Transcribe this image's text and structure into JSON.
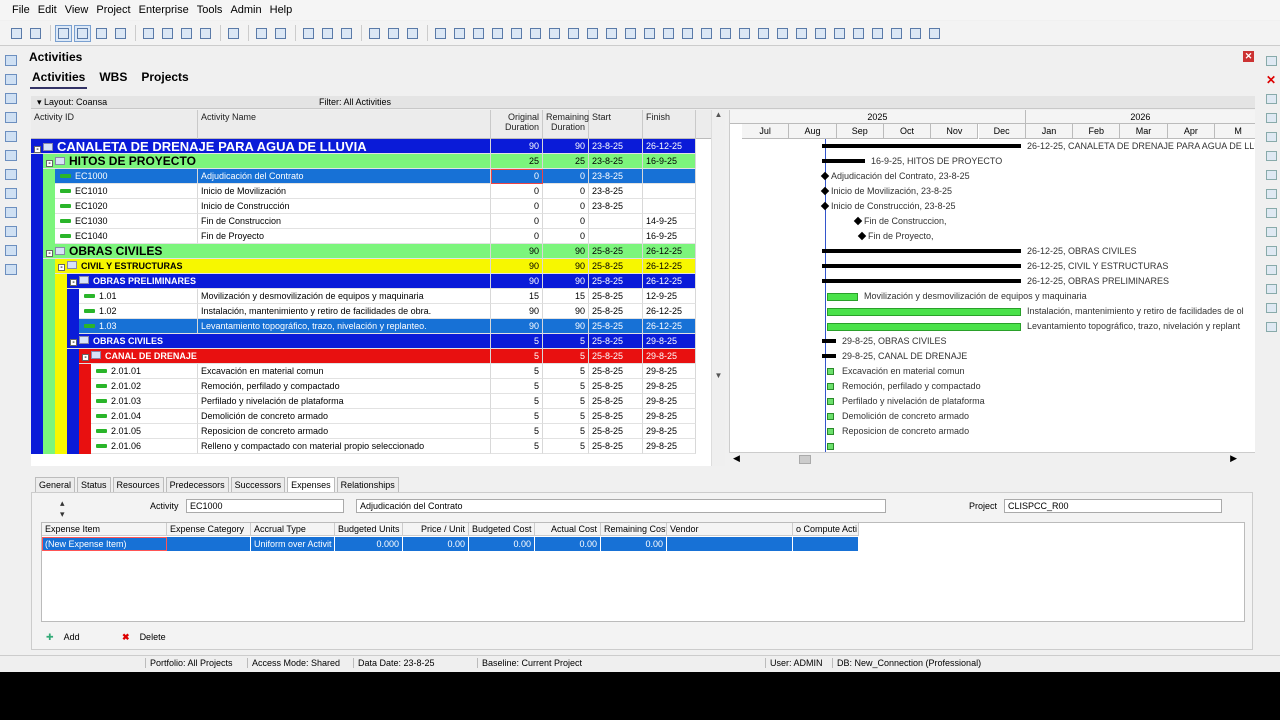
{
  "menu": [
    "File",
    "Edit",
    "View",
    "Project",
    "Enterprise",
    "Tools",
    "Admin",
    "Help"
  ],
  "panel_title": "Activities",
  "view_tabs": [
    "Activities",
    "WBS",
    "Projects"
  ],
  "layout_label": "Layout: Coansa",
  "filter_label": "Filter: All Activities",
  "columns": {
    "id": "Activity ID",
    "name": "Activity Name",
    "orig": "Original Duration",
    "rem": "Remaining Duration",
    "start": "Start",
    "finish": "Finish"
  },
  "rows": [
    {
      "level": 0,
      "type": "wbs",
      "id": "CANALETA DE DRENAJE PARA AGUA DE LLUVIA",
      "name": "",
      "orig": "90",
      "rem": "90",
      "start": "23-8-25",
      "finish": "26-12-25",
      "bg": "#0a1bd8",
      "fg": "#ffffff",
      "gantt_label": "26-12-25, CANALETA DE DRENAJE PARA AGUA DE LLUVIA"
    },
    {
      "level": 1,
      "type": "wbs",
      "id": "HITOS DE PROYECTO",
      "name": "",
      "orig": "25",
      "rem": "25",
      "start": "23-8-25",
      "finish": "16-9-25",
      "bg": "#7cf57c",
      "fg": "#000000",
      "gantt_label": "16-9-25, HITOS DE PROYECTO"
    },
    {
      "level": 2,
      "type": "act",
      "id": "EC1000",
      "name": "Adjudicación del Contrato",
      "orig": "0",
      "rem": "0",
      "start": "23-8-25",
      "finish": "",
      "bg": "#1771d6",
      "fg": "#ffffff",
      "selected": true,
      "gantt_label": "Adjudicación del Contrato, 23-8-25"
    },
    {
      "level": 2,
      "type": "act",
      "id": "EC1010",
      "name": "Inicio de Movilización",
      "orig": "0",
      "rem": "0",
      "start": "23-8-25",
      "finish": "",
      "bg": "#ffffff",
      "fg": "#000000",
      "gantt_label": "Inicio de Movilización, 23-8-25"
    },
    {
      "level": 2,
      "type": "act",
      "id": "EC1020",
      "name": "Inicio de Construcción",
      "orig": "0",
      "rem": "0",
      "start": "23-8-25",
      "finish": "",
      "bg": "#ffffff",
      "fg": "#000000",
      "gantt_label": "Inicio de Construcción, 23-8-25"
    },
    {
      "level": 2,
      "type": "act",
      "id": "EC1030",
      "name": "Fin de Construccion",
      "orig": "0",
      "rem": "0",
      "start": "",
      "finish": "14-9-25",
      "bg": "#ffffff",
      "fg": "#000000",
      "gantt_label": "Fin de Construccion,"
    },
    {
      "level": 2,
      "type": "act",
      "id": "EC1040",
      "name": "Fin de Proyecto",
      "orig": "0",
      "rem": "0",
      "start": "",
      "finish": "16-9-25",
      "bg": "#ffffff",
      "fg": "#000000",
      "gantt_label": "Fin de Proyecto,"
    },
    {
      "level": 1,
      "type": "wbs",
      "id": "OBRAS CIVILES",
      "name": "",
      "orig": "90",
      "rem": "90",
      "start": "25-8-25",
      "finish": "26-12-25",
      "bg": "#7cf57c",
      "fg": "#000000",
      "gantt_label": "26-12-25, OBRAS CIVILES"
    },
    {
      "level": 2,
      "type": "wbs",
      "id": "CIVIL Y ESTRUCTURAS",
      "name": "",
      "orig": "90",
      "rem": "90",
      "start": "25-8-25",
      "finish": "26-12-25",
      "bg": "#f7f700",
      "fg": "#000000",
      "gantt_label": "26-12-25, CIVIL Y ESTRUCTURAS"
    },
    {
      "level": 3,
      "type": "wbs",
      "id": "OBRAS PRELIMINARES",
      "name": "",
      "orig": "90",
      "rem": "90",
      "start": "25-8-25",
      "finish": "26-12-25",
      "bg": "#0a1bd8",
      "fg": "#ffffff",
      "gantt_label": "26-12-25, OBRAS PRELIMINARES"
    },
    {
      "level": 4,
      "type": "act",
      "id": "1.01",
      "name": "Movilización y desmovilización de equipos y maquinaria",
      "orig": "15",
      "rem": "15",
      "start": "25-8-25",
      "finish": "12-9-25",
      "bg": "#ffffff",
      "fg": "#000000",
      "gantt_label": "Movilización y desmovilización de equipos y maquinaria"
    },
    {
      "level": 4,
      "type": "act",
      "id": "1.02",
      "name": "Instalación, mantenimiento y retiro de facilidades de obra.",
      "orig": "90",
      "rem": "90",
      "start": "25-8-25",
      "finish": "26-12-25",
      "bg": "#ffffff",
      "fg": "#000000",
      "gantt_label": "Instalación, mantenimiento y retiro de facilidades de ol"
    },
    {
      "level": 4,
      "type": "act",
      "id": "1.03",
      "name": "Levantamiento topográfico, trazo, nivelación y replanteo.",
      "orig": "90",
      "rem": "90",
      "start": "25-8-25",
      "finish": "26-12-25",
      "bg": "#1771d6",
      "fg": "#ffffff",
      "gantt_label": "Levantamiento topográfico, trazo, nivelación y replant"
    },
    {
      "level": 3,
      "type": "wbs",
      "id": "OBRAS CIVILES",
      "name": "",
      "orig": "5",
      "rem": "5",
      "start": "25-8-25",
      "finish": "29-8-25",
      "bg": "#0a1bd8",
      "fg": "#ffffff",
      "gantt_label": "29-8-25, OBRAS CIVILES"
    },
    {
      "level": 4,
      "type": "wbs",
      "id": "CANAL DE DRENAJE",
      "name": "",
      "orig": "5",
      "rem": "5",
      "start": "25-8-25",
      "finish": "29-8-25",
      "bg": "#e81010",
      "fg": "#ffffff",
      "gantt_label": "29-8-25, CANAL DE DRENAJE"
    },
    {
      "level": 5,
      "type": "act",
      "id": "2.01.01",
      "name": "Excavación en material comun",
      "orig": "5",
      "rem": "5",
      "start": "25-8-25",
      "finish": "29-8-25",
      "bg": "#ffffff",
      "fg": "#000000",
      "gantt_label": "Excavación en material comun"
    },
    {
      "level": 5,
      "type": "act",
      "id": "2.01.02",
      "name": "Remoción, perfilado y compactado",
      "orig": "5",
      "rem": "5",
      "start": "25-8-25",
      "finish": "29-8-25",
      "bg": "#ffffff",
      "fg": "#000000",
      "gantt_label": "Remoción, perfilado y compactado"
    },
    {
      "level": 5,
      "type": "act",
      "id": "2.01.03",
      "name": "Perfilado y nivelación de plataforma",
      "orig": "5",
      "rem": "5",
      "start": "25-8-25",
      "finish": "29-8-25",
      "bg": "#ffffff",
      "fg": "#000000",
      "gantt_label": "Perfilado y nivelación de plataforma"
    },
    {
      "level": 5,
      "type": "act",
      "id": "2.01.04",
      "name": "Demolición de concreto armado",
      "orig": "5",
      "rem": "5",
      "start": "25-8-25",
      "finish": "29-8-25",
      "bg": "#ffffff",
      "fg": "#000000",
      "gantt_label": "Demolición de concreto armado"
    },
    {
      "level": 5,
      "type": "act",
      "id": "2.01.05",
      "name": "Reposicion de concreto armado",
      "orig": "5",
      "rem": "5",
      "start": "25-8-25",
      "finish": "29-8-25",
      "bg": "#ffffff",
      "fg": "#000000",
      "gantt_label": "Reposicion de concreto armado"
    },
    {
      "level": 5,
      "type": "act",
      "id": "2.01.06",
      "name": "Relleno y compactado con material propio seleccionado",
      "orig": "5",
      "rem": "5",
      "start": "25-8-25",
      "finish": "29-8-25",
      "bg": "#ffffff",
      "fg": "#000000",
      "gantt_label": ""
    }
  ],
  "timescale": {
    "years": [
      "2025",
      "2026"
    ],
    "months": [
      "Jul",
      "Aug",
      "Sep",
      "Oct",
      "Nov",
      "Dec",
      "Jan",
      "Feb",
      "Mar",
      "Apr",
      "M"
    ]
  },
  "detail_tabs": [
    "General",
    "Status",
    "Resources",
    "Predecessors",
    "Successors",
    "Expenses",
    "Relationships"
  ],
  "detail": {
    "activity_label": "Activity",
    "activity_id": "EC1000",
    "activity_name": "Adjudicación del Contrato",
    "project_label": "Project",
    "project_id": "CLISPCC_R00",
    "expense_columns": [
      "Expense Item",
      "Expense Category",
      "Accrual Type",
      "Budgeted Units",
      "Price / Unit",
      "Budgeted Cost",
      "Actual Cost",
      "Remaining Cost",
      "Vendor",
      "o Compute Acti"
    ],
    "expense_row": [
      "(New Expense Item)",
      "",
      "Uniform over Activit",
      "0.000",
      "0.00",
      "0.00",
      "0.00",
      "0.00",
      "",
      ""
    ],
    "add_label": "Add",
    "delete_label": "Delete"
  },
  "status": {
    "portfolio": "Portfolio: All Projects",
    "access": "Access Mode: Shared",
    "data_date": "Data Date: 23-8-25",
    "baseline": "Baseline: Current Project",
    "user": "User: ADMIN",
    "db": "DB: New_Connection (Professional)"
  }
}
